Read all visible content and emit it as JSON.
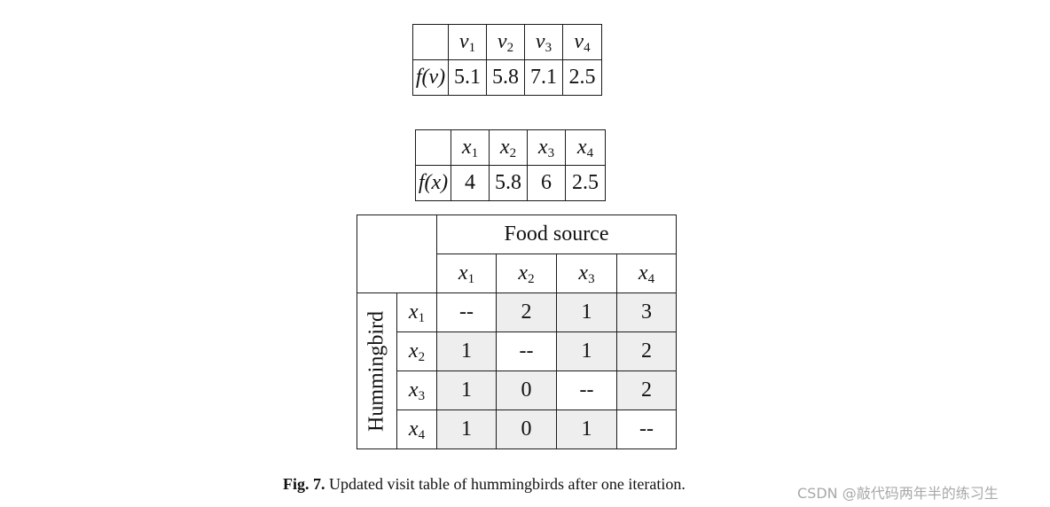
{
  "table_v": {
    "header": [
      "",
      "v",
      "v",
      "v",
      "v"
    ],
    "header_subs": [
      "",
      "1",
      "2",
      "3",
      "4"
    ],
    "row_label": "f(v)",
    "values": [
      "5.1",
      "5.8",
      "7.1",
      "2.5"
    ]
  },
  "table_x": {
    "header": [
      "",
      "x",
      "x",
      "x",
      "x"
    ],
    "header_subs": [
      "",
      "1",
      "2",
      "3",
      "4"
    ],
    "row_label": "f(x)",
    "values": [
      "4",
      "5.8",
      "6",
      "2.5"
    ]
  },
  "visit_table": {
    "column_group_label": "Food source",
    "row_group_label": "Hummingbird",
    "columns": [
      {
        "var": "x",
        "sub": "1"
      },
      {
        "var": "x",
        "sub": "2"
      },
      {
        "var": "x",
        "sub": "3"
      },
      {
        "var": "x",
        "sub": "4"
      }
    ],
    "rows": [
      {
        "var": "x",
        "sub": "1",
        "cells": [
          "--",
          "2",
          "1",
          "3"
        ]
      },
      {
        "var": "x",
        "sub": "2",
        "cells": [
          "1",
          "--",
          "1",
          "2"
        ]
      },
      {
        "var": "x",
        "sub": "3",
        "cells": [
          "1",
          "0",
          "--",
          "2"
        ]
      },
      {
        "var": "x",
        "sub": "4",
        "cells": [
          "1",
          "0",
          "1",
          "--"
        ]
      }
    ],
    "shade_color": "#eeeeee"
  },
  "caption": {
    "label": "Fig. 7.",
    "text": " Updated visit table of hummingbirds after one iteration."
  },
  "watermark": "CSDN @敲代码两年半的练习生"
}
